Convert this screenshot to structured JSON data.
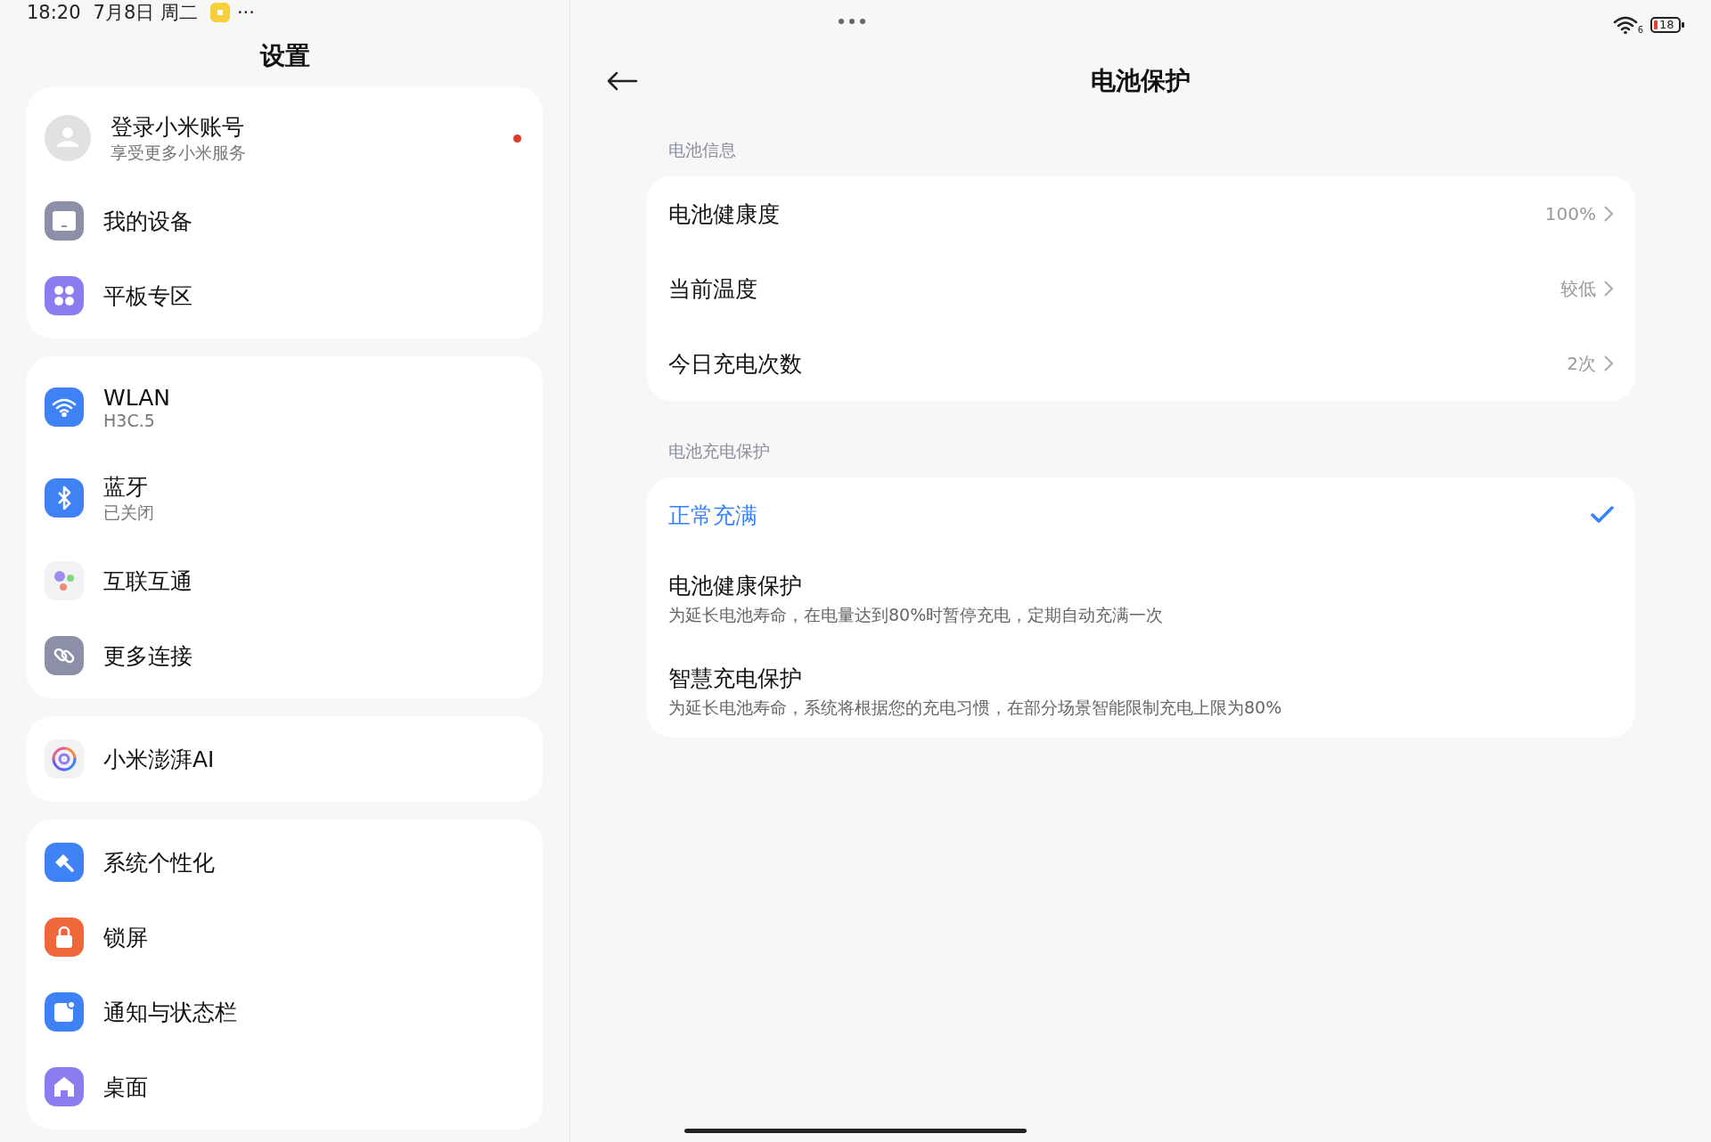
{
  "status_bar": {
    "time": "18:20",
    "date": "7月8日 周二",
    "more": "···",
    "wifi_badge": "6",
    "battery": "18"
  },
  "sidebar": {
    "title": "设置",
    "groups": [
      {
        "items": [
          {
            "kind": "account",
            "label": "登录小米账号",
            "sublabel": "享受更多小米服务",
            "unread": true
          },
          {
            "kind": "device",
            "label": "我的设备",
            "unread": false
          },
          {
            "kind": "tablet",
            "label": "平板专区",
            "unread": false
          }
        ]
      },
      {
        "items": [
          {
            "kind": "wifi",
            "label": "WLAN",
            "sublabel": "H3C.5",
            "unread": false
          },
          {
            "kind": "bluetooth",
            "label": "蓝牙",
            "sublabel": "已关闭",
            "unread": false
          },
          {
            "kind": "interconnect",
            "label": "互联互通",
            "unread": false
          },
          {
            "kind": "link",
            "label": "更多连接",
            "unread": false
          }
        ]
      },
      {
        "items": [
          {
            "kind": "ai",
            "label": "小米澎湃AI",
            "unread": false
          }
        ]
      },
      {
        "items": [
          {
            "kind": "theme",
            "label": "系统个性化",
            "unread": false
          },
          {
            "kind": "lock",
            "label": "锁屏",
            "unread": false
          },
          {
            "kind": "notification",
            "label": "通知与状态栏",
            "unread": false
          },
          {
            "kind": "home",
            "label": "桌面",
            "unread": false
          }
        ]
      }
    ]
  },
  "detail": {
    "title": "电池保护",
    "sections": [
      {
        "header": "电池信息",
        "kind": "info",
        "rows": [
          {
            "label": "电池健康度",
            "value": "100%"
          },
          {
            "label": "当前温度",
            "value": "较低"
          },
          {
            "label": "今日充电次数",
            "value": "2次"
          }
        ]
      },
      {
        "header": "电池充电保护",
        "kind": "options",
        "rows": [
          {
            "label": "正常充满",
            "selected": true
          },
          {
            "label": "电池健康保护",
            "description": "为延长电池寿命，在电量达到80%时暂停充电，定期自动充满一次",
            "selected": false
          },
          {
            "label": "智慧充电保护",
            "description": "为延长电池寿命，系统将根据您的充电习惯，在部分场景智能限制充电上限为80%",
            "selected": false
          }
        ]
      }
    ]
  }
}
